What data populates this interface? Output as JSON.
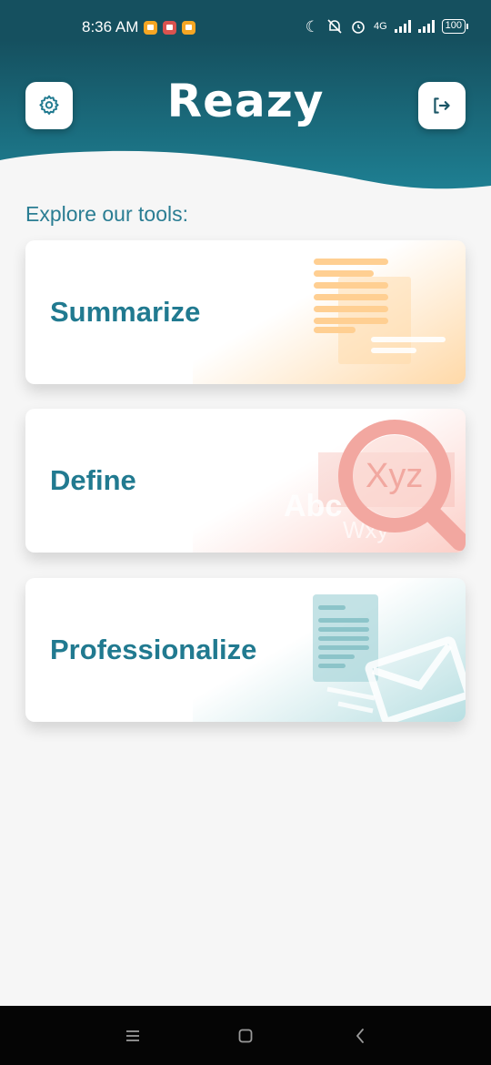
{
  "status_bar": {
    "time": "8:36 AM",
    "network": "4G",
    "battery": "100",
    "icons": [
      "app-notification-icon",
      "app-notification-icon",
      "app-notification-icon",
      "moon-icon",
      "bell-muted-icon",
      "alarm-icon",
      "signal-icon",
      "signal-icon",
      "battery-icon"
    ]
  },
  "header": {
    "title": "Reazy",
    "left_icon": "gear-icon",
    "right_icon": "logout-icon",
    "colors": {
      "top": "#15505f",
      "bottom": "#1e7a8c"
    }
  },
  "main": {
    "section_title": "Explore our tools:",
    "tools": [
      {
        "label": "Summarize",
        "accent": "#ffd9a8"
      },
      {
        "label": "Define",
        "accent": "#fccfc8",
        "art_text": [
          "Xyz",
          "Abc",
          "Wxy"
        ]
      },
      {
        "label": "Professionalize",
        "accent": "#b8dfe2"
      }
    ],
    "text_color": "#217a90"
  },
  "nav_bar": {
    "icons": [
      "menu-icon",
      "home-icon",
      "back-icon"
    ]
  }
}
